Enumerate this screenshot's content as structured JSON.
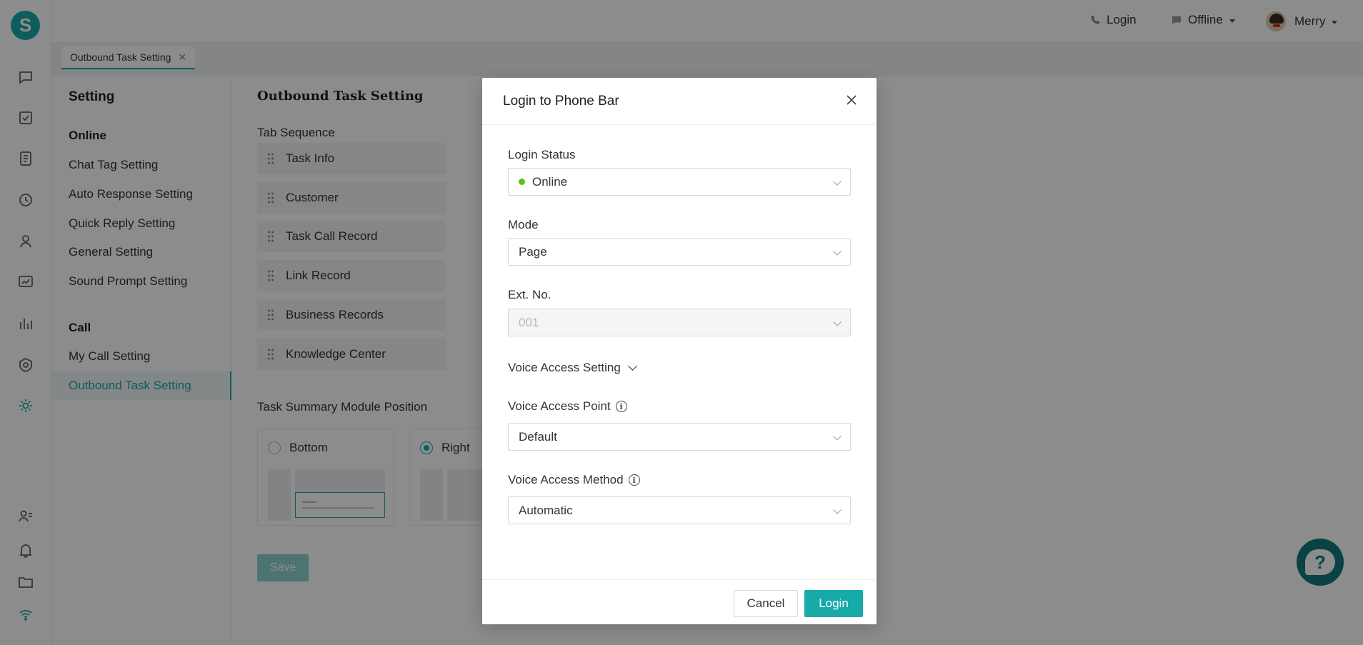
{
  "app": {
    "logo_letter": "S"
  },
  "header": {
    "login_label": "Login",
    "status_label": "Offline",
    "user_name": "Merry"
  },
  "tabs": [
    {
      "label": "Outbound Task Setting",
      "close": "✕"
    }
  ],
  "setting_sidebar": {
    "title": "Setting",
    "sections": [
      {
        "title": "Online",
        "items": [
          "Chat Tag Setting",
          "Auto Response Setting",
          "Quick Reply Setting",
          "General Setting",
          "Sound Prompt Setting"
        ]
      },
      {
        "title": "Call",
        "items": [
          "My Call Setting",
          "Outbound Task Setting"
        ]
      }
    ],
    "active_item": "Outbound Task Setting"
  },
  "main": {
    "title": "Outbound Task Setting",
    "tab_sequence_label": "Tab Sequence",
    "tab_sequence": [
      "Task Info",
      "Customer",
      "Task Call Record",
      "Link Record",
      "Business Records",
      "Knowledge Center"
    ],
    "summary_position_label": "Task Summary Module Position",
    "positions": [
      {
        "label": "Bottom",
        "selected": false
      },
      {
        "label": "Right",
        "selected": true
      }
    ],
    "save_label": "Save"
  },
  "modal": {
    "title": "Login to Phone Bar",
    "close_icon": "close-icon",
    "fields": {
      "login_status": {
        "label": "Login Status",
        "value": "Online",
        "status_color": "#52c41a"
      },
      "mode": {
        "label": "Mode",
        "value": "Page"
      },
      "ext_no": {
        "label": "Ext. No.",
        "value": "001",
        "disabled": true
      },
      "voice_access_toggle": "Voice Access Setting",
      "voice_access_point": {
        "label": "Voice Access Point",
        "value": "Default"
      },
      "voice_access_method": {
        "label": "Voice Access Method",
        "value": "Automatic"
      }
    },
    "cancel_label": "Cancel",
    "login_label": "Login"
  },
  "colors": {
    "accent": "#18a9a9",
    "online": "#52c41a",
    "help_bg": "#137a7a"
  }
}
